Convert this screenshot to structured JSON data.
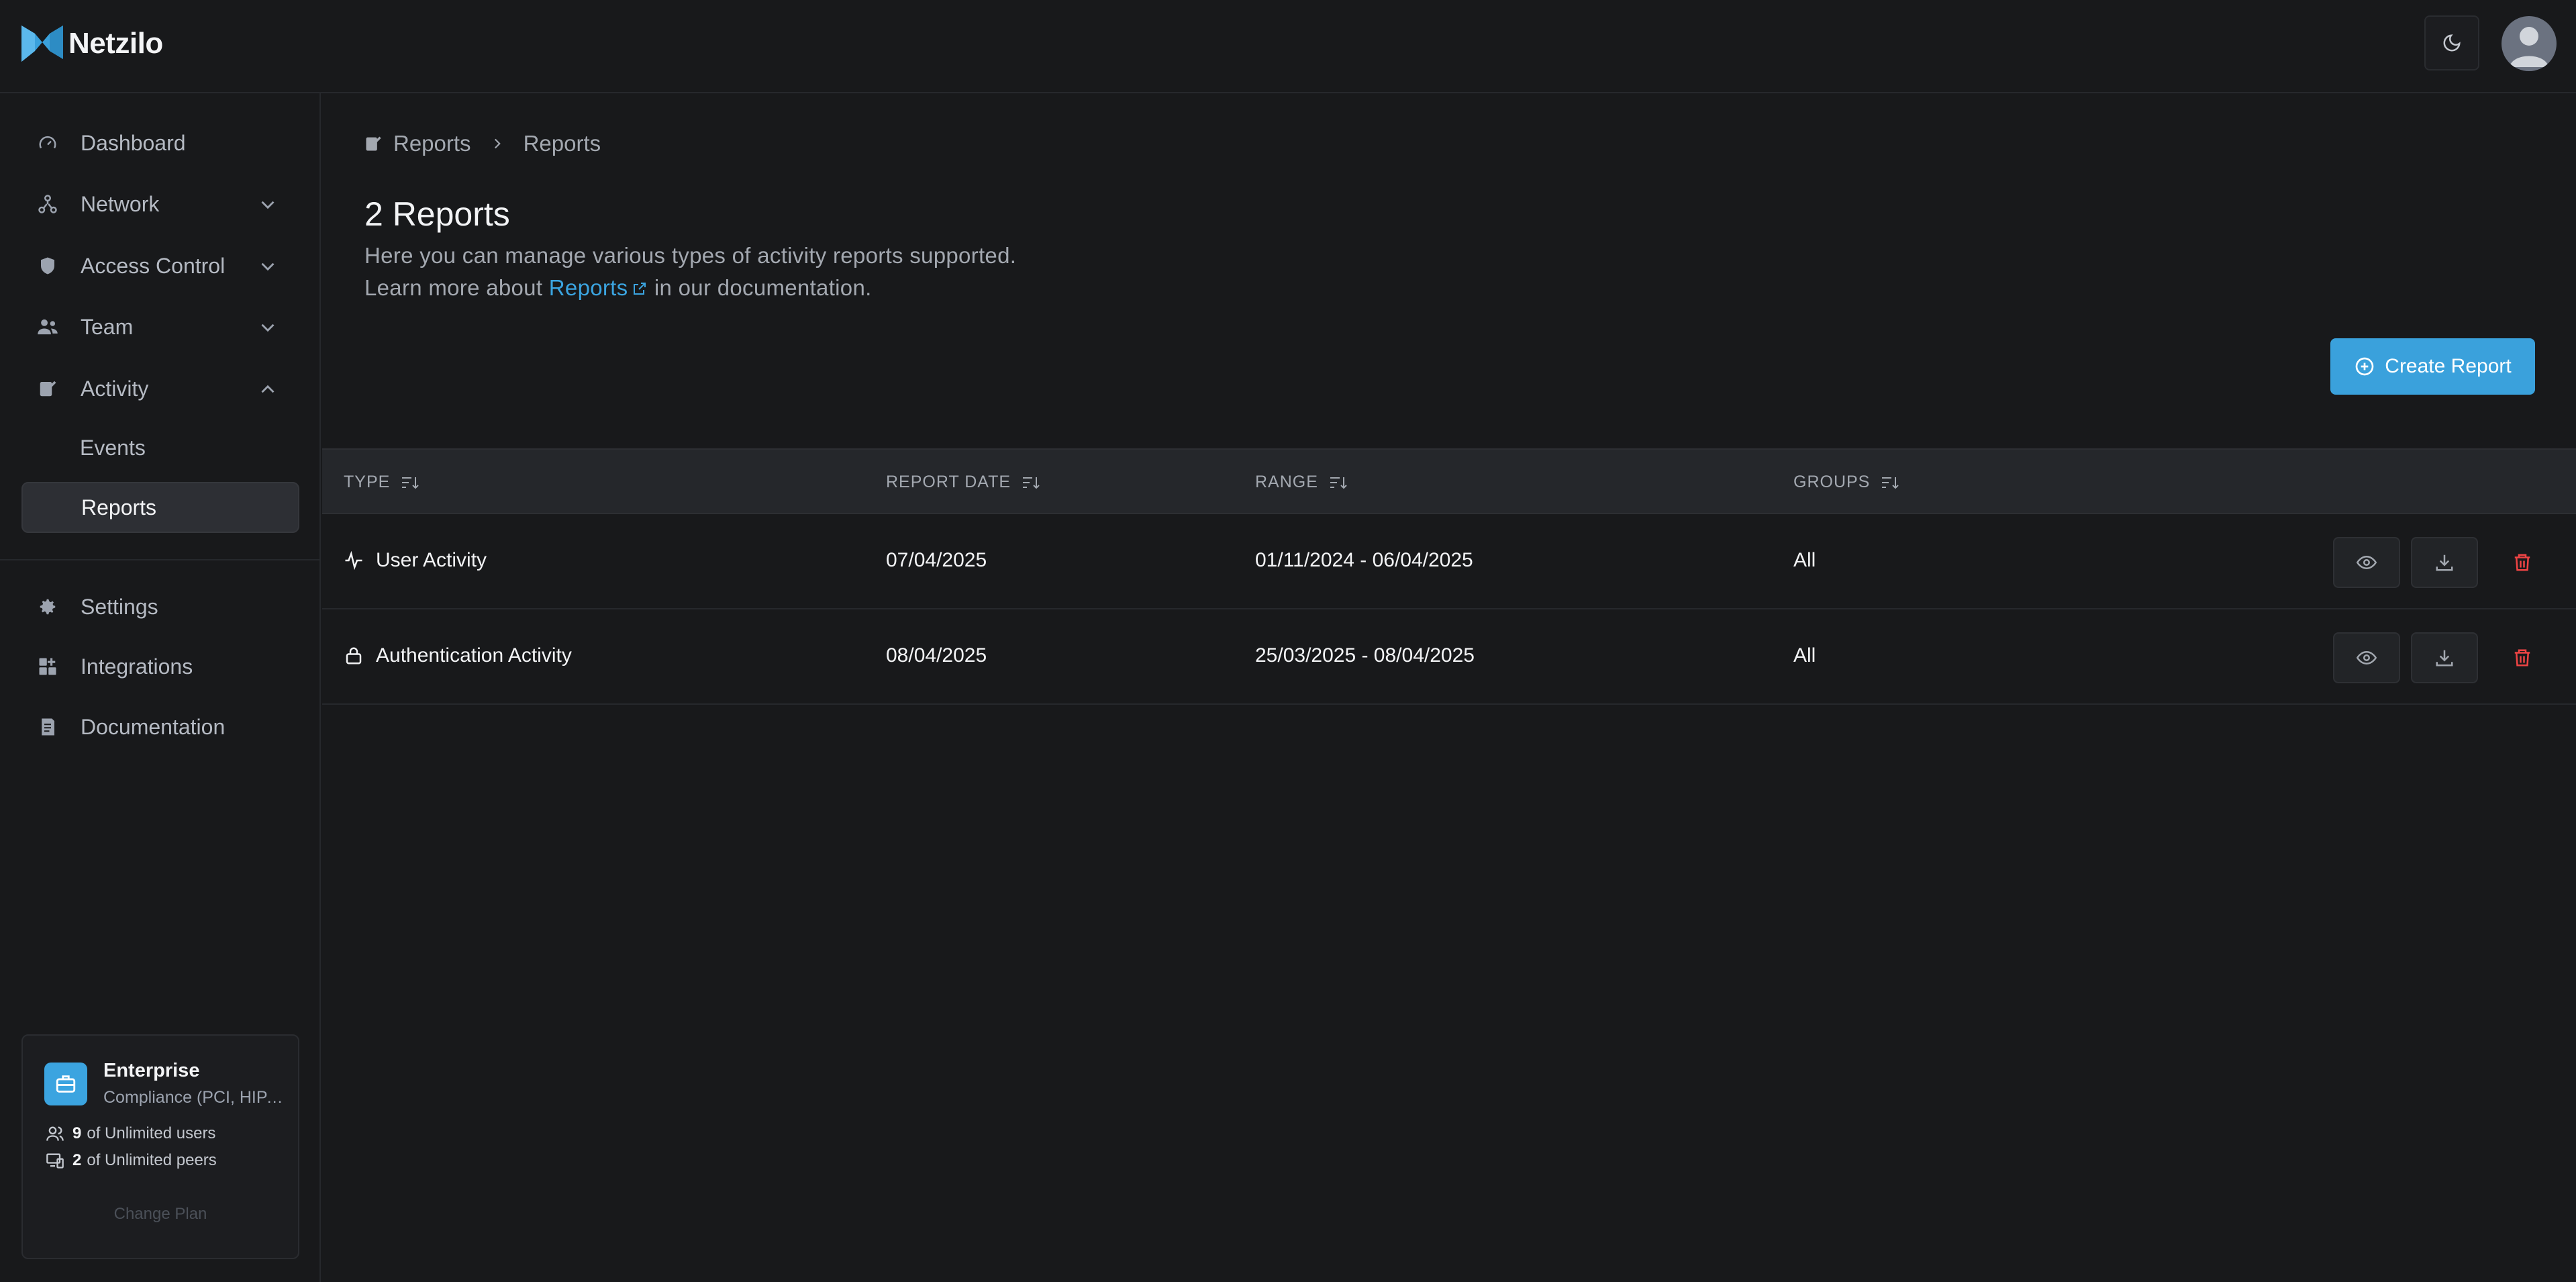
{
  "app": {
    "name": "Netzilo"
  },
  "sidebar": {
    "items": [
      {
        "label": "Dashboard",
        "icon": "gauge-icon"
      },
      {
        "label": "Network",
        "icon": "network-icon"
      },
      {
        "label": "Access Control",
        "icon": "shield-icon"
      },
      {
        "label": "Team",
        "icon": "users-icon"
      },
      {
        "label": "Activity",
        "icon": "activity-icon"
      },
      {
        "label": "Settings",
        "icon": "gear-icon"
      },
      {
        "label": "Integrations",
        "icon": "integrations-icon"
      },
      {
        "label": "Documentation",
        "icon": "book-icon"
      }
    ],
    "activity_sub": [
      {
        "label": "Events"
      },
      {
        "label": "Reports"
      }
    ]
  },
  "plan": {
    "title": "Enterprise",
    "subtitle": "Compliance (PCI, HIPAA…",
    "users_count": "9",
    "users_text": "of Unlimited users",
    "peers_count": "2",
    "peers_text": "of Unlimited peers",
    "change_label": "Change Plan"
  },
  "breadcrumb": {
    "root": "Reports",
    "current": "Reports"
  },
  "page": {
    "title": "2 Reports",
    "desc_line1": "Here you can manage various types of activity reports supported.",
    "desc_prefix": "Learn more about",
    "desc_link": "Reports",
    "desc_suffix": "in our documentation.",
    "create_label": "Create Report"
  },
  "table": {
    "columns": [
      "TYPE",
      "REPORT DATE",
      "RANGE",
      "GROUPS"
    ],
    "rows": [
      {
        "type": "User Activity",
        "icon": "pulse-icon",
        "date": "07/04/2025",
        "range": "01/11/2024 - 06/04/2025",
        "groups": "All"
      },
      {
        "type": "Authentication Activity",
        "icon": "lock-icon",
        "date": "08/04/2025",
        "range": "25/03/2025 - 08/04/2025",
        "groups": "All"
      }
    ]
  },
  "colors": {
    "accent": "#3ba4e0",
    "danger": "#ef4444",
    "background": "#18191b"
  }
}
